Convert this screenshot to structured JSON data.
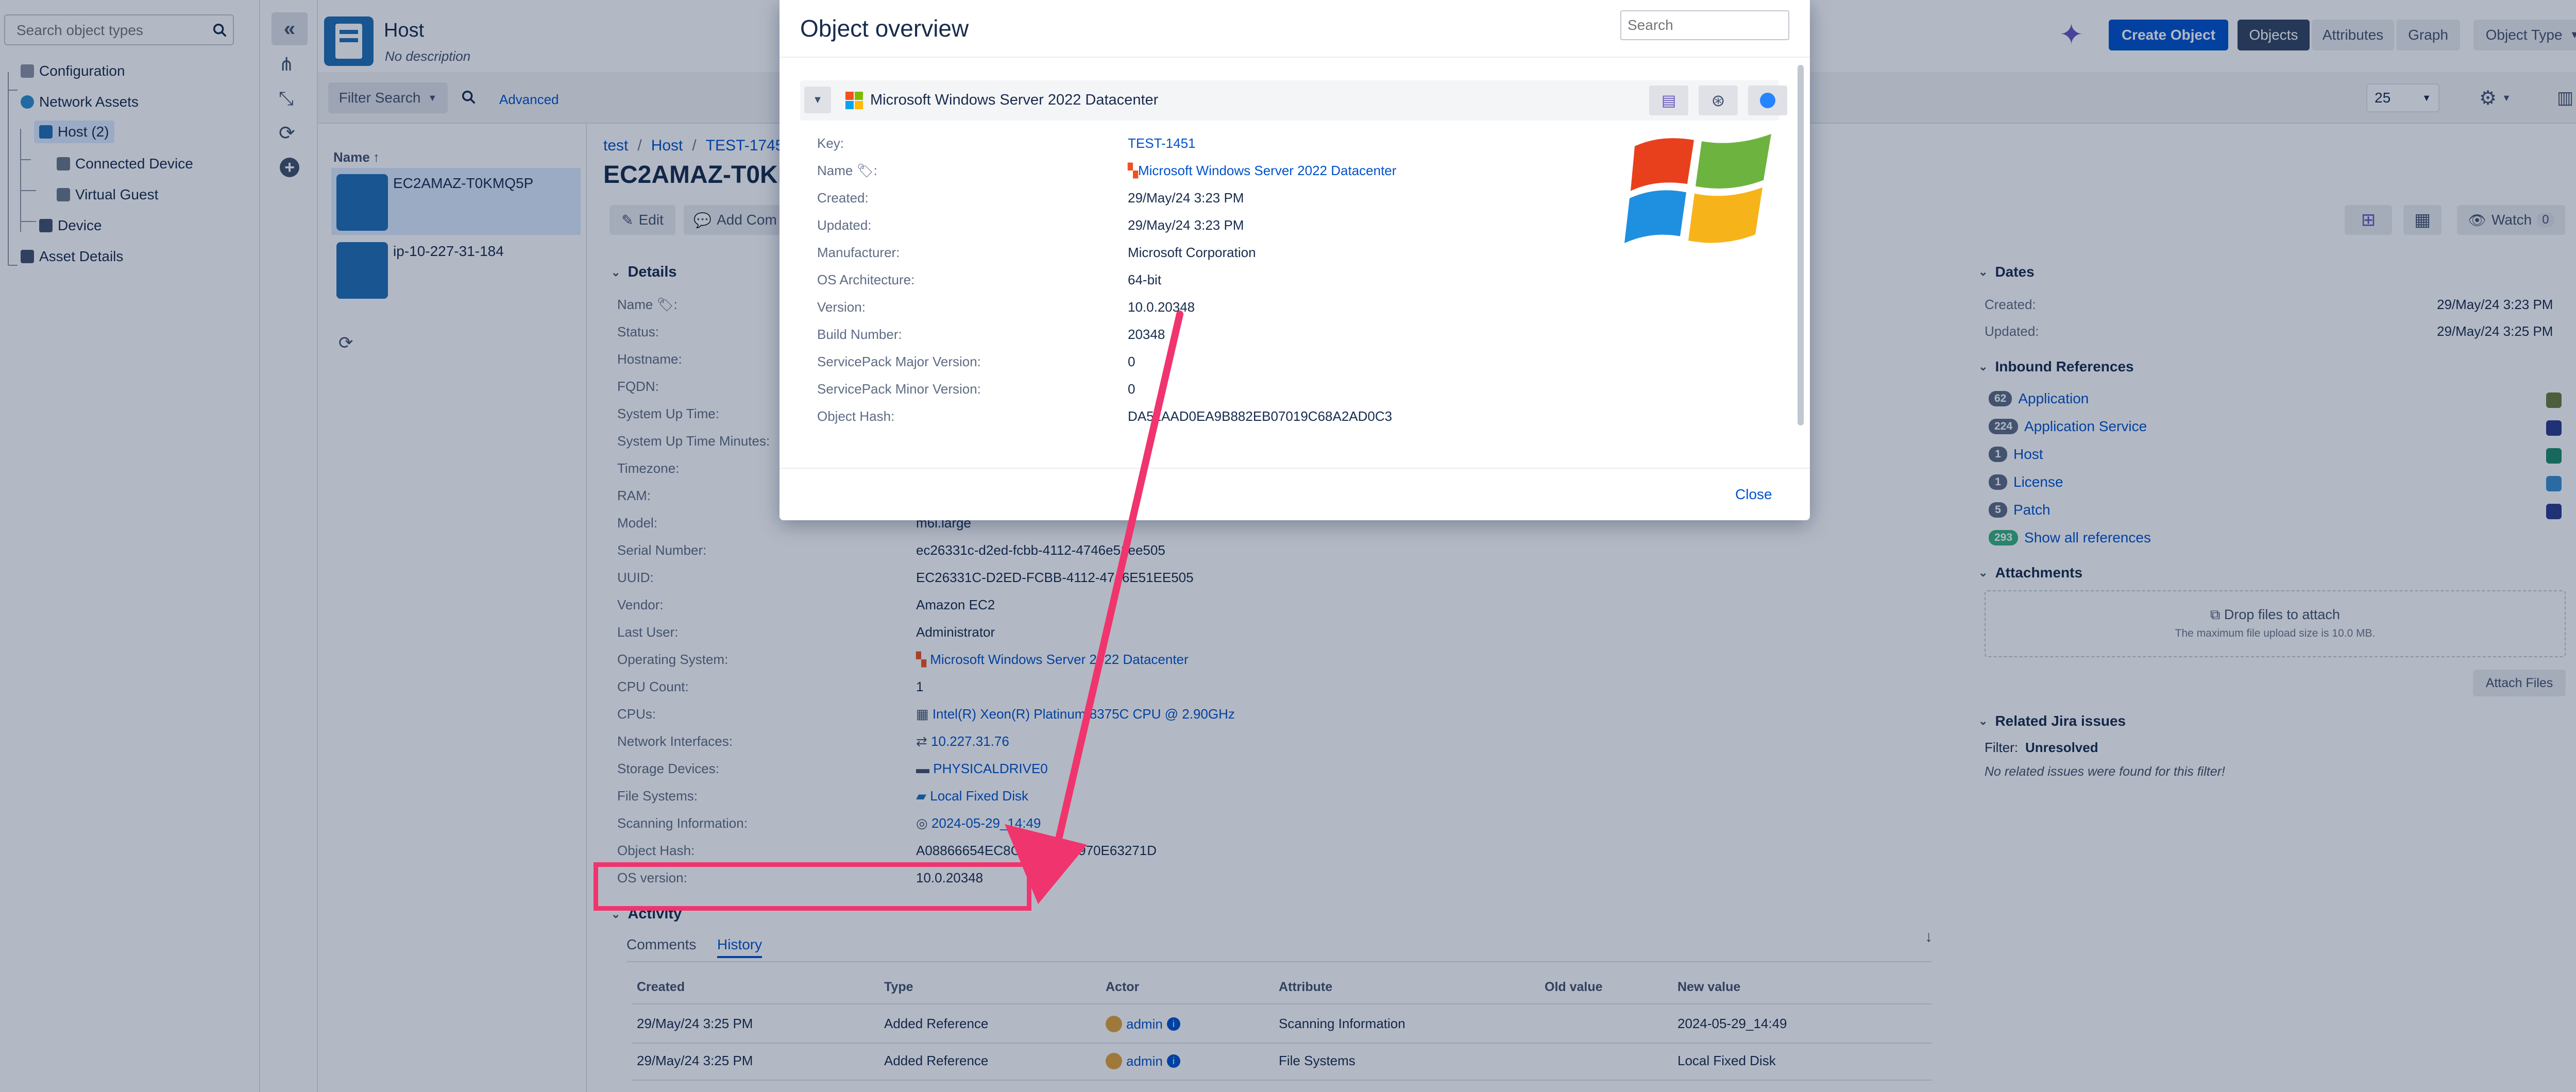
{
  "left_panel": {
    "search_placeholder": "Search object types",
    "tree": [
      {
        "label": "Configuration"
      },
      {
        "label": "Network Assets"
      },
      {
        "label": "Host (2)"
      },
      {
        "label": "Connected Device"
      },
      {
        "label": "Virtual Guest"
      },
      {
        "label": "Device"
      },
      {
        "label": "Asset Details"
      }
    ]
  },
  "header": {
    "type_title": "Host",
    "type_description": "No description",
    "create_object": "Create Object",
    "tabs": [
      "Objects",
      "Attributes",
      "Graph"
    ],
    "object_type_dropdown": "Object Type",
    "filter_search": "Filter Search",
    "advanced": "Advanced",
    "page_size": "25"
  },
  "object_list": {
    "column_header": "Name",
    "items": [
      "EC2AMAZ-T0KMQ5P",
      "ip-10-227-31-184"
    ]
  },
  "breadcrumb": [
    "test",
    "Host",
    "TEST-1745"
  ],
  "object_title": "EC2AMAZ-T0KMQ5P",
  "actions": {
    "edit": "Edit",
    "add_comment": "Add Com",
    "watch": "Watch",
    "watch_count": "0"
  },
  "details": {
    "title": "Details",
    "labels": [
      "Name",
      "Status:",
      "Hostname:",
      "FQDN:",
      "System Up Time:",
      "System Up Time Minutes:",
      "Timezone:",
      "RAM:",
      "Model:",
      "Serial Number:",
      "UUID:",
      "Vendor:",
      "Last User:",
      "Operating System:",
      "CPU Count:",
      "CPUs:",
      "Network Interfaces:",
      "Storage Devices:",
      "File Systems:",
      "Scanning Information:",
      "Object Hash:",
      "OS version:"
    ],
    "name_colon": ":",
    "model": "m6i.large",
    "serial_number": "ec26331c-d2ed-fcbb-4112-4746e51ee505",
    "uuid": "EC26331C-D2ED-FCBB-4112-4746E51EE505",
    "vendor": "Amazon EC2",
    "last_user": "Administrator",
    "operating_system": "Microsoft Windows Server 2022 Datacenter",
    "cpu_count": "1",
    "cpus": "Intel(R) Xeon(R) Platinum 8375C CPU @ 2.90GHz",
    "network_interfaces": "10.227.31.76",
    "storage_devices": "PHYSICALDRIVE0",
    "file_systems": "Local Fixed Disk",
    "scanning_information": "2024-05-29_14:49",
    "object_hash": "A08866654EC8C7E5E5BE970E63271D",
    "os_version": "10.0.20348"
  },
  "activity": {
    "title": "Activity",
    "tabs": [
      "Comments",
      "History"
    ],
    "columns": [
      "Created",
      "Type",
      "Actor",
      "Attribute",
      "Old value",
      "New value"
    ],
    "rows": [
      {
        "created": "29/May/24 3:25 PM",
        "type": "Added Reference",
        "actor": "admin",
        "attribute": "Scanning Information",
        "old": "",
        "new": "2024-05-29_14:49"
      },
      {
        "created": "29/May/24 3:25 PM",
        "type": "Added Reference",
        "actor": "admin",
        "attribute": "File Systems",
        "old": "",
        "new": "Local Fixed Disk"
      }
    ]
  },
  "right_panel": {
    "dates_title": "Dates",
    "created_label": "Created:",
    "created_value": "29/May/24 3:23 PM",
    "updated_label": "Updated:",
    "updated_value": "29/May/24 3:25 PM",
    "inbound_title": "Inbound References",
    "inbound": [
      {
        "count": "62",
        "label": "Application",
        "color": "#6b7d3a"
      },
      {
        "count": "224",
        "label": "Application Service",
        "color": "#2b3a8f"
      },
      {
        "count": "1",
        "label": "Host",
        "color": "#1f8a6b"
      },
      {
        "count": "1",
        "label": "License",
        "color": "#3a8fd1"
      },
      {
        "count": "5",
        "label": "Patch",
        "color": "#2b3a8f"
      },
      {
        "count": "293",
        "label": "Show all references",
        "color": ""
      }
    ],
    "attachments_title": "Attachments",
    "drop_files": "Drop files to attach",
    "max_size": "The maximum file upload size is 10.0 MB.",
    "attach_files": "Attach Files",
    "jira_title": "Related Jira issues",
    "filter_label": "Filter:",
    "filter_value": "Unresolved",
    "no_issues": "No related issues were found for this filter!"
  },
  "modal": {
    "title": "Object overview",
    "search_placeholder": "Search",
    "object_name": "Microsoft Windows Server 2022 Datacenter",
    "fields": [
      {
        "label": "Key:",
        "value": "TEST-1451"
      },
      {
        "label": "Name",
        "value": "Microsoft Windows Server 2022 Datacenter"
      },
      {
        "label": "Created:",
        "value": "29/May/24 3:23 PM"
      },
      {
        "label": "Updated:",
        "value": "29/May/24 3:23 PM"
      },
      {
        "label": "Manufacturer:",
        "value": "Microsoft Corporation"
      },
      {
        "label": "OS Architecture:",
        "value": "64-bit"
      },
      {
        "label": "Version:",
        "value": "10.0.20348"
      },
      {
        "label": "Build Number:",
        "value": "20348"
      },
      {
        "label": "ServicePack Major Version:",
        "value": "0"
      },
      {
        "label": "ServicePack Minor Version:",
        "value": "0"
      },
      {
        "label": "Object Hash:",
        "value": "DA51AAD0EA9B882EB07019C68A2AD0C3"
      }
    ],
    "name_colon": ":",
    "close": "Close"
  },
  "colors": {
    "primary": "#0052cc",
    "annotation": "#f0346e",
    "overlay": "rgba(9,30,66,0.31)"
  }
}
